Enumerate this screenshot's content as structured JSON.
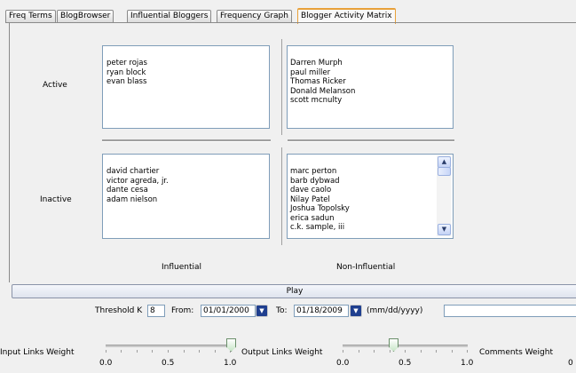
{
  "tabs": [
    {
      "label": "Freq Terms"
    },
    {
      "label": "BlogBrowser"
    },
    {
      "label": "Influential Bloggers"
    },
    {
      "label": "Frequency Graph"
    },
    {
      "label": "Blogger Activity Matrix",
      "active": true
    }
  ],
  "matrix": {
    "rows": [
      "Active",
      "Inactive"
    ],
    "columns": [
      "Influential",
      "Non-Influential"
    ],
    "active_influential": [
      "peter rojas",
      "ryan block",
      "evan blass"
    ],
    "active_noninfluential": [
      "Darren Murph",
      "paul miller",
      "Thomas Ricker",
      "Donald Melanson",
      "scott mcnulty"
    ],
    "inactive_influential": [
      "david chartier",
      "victor agreda, jr.",
      "dante cesa",
      "adam nielson"
    ],
    "inactive_noninfluential": [
      "marc perton",
      "barb dybwad",
      "dave caolo",
      "Nilay Patel",
      "Joshua Topolsky",
      "erica sadun",
      "c.k. sample, iii"
    ]
  },
  "play_label": "Play",
  "controls": {
    "threshold_label": "Threshold K",
    "threshold_value": "8",
    "from_label": "From:",
    "from_value": "01/01/2000",
    "to_label": "To:",
    "to_value": "01/18/2009",
    "date_format_hint": "(mm/dd/yyyy)",
    "search_value": ""
  },
  "sliders": {
    "input_links": {
      "label": "Input Links Weight",
      "value": 1.0,
      "ticks": [
        "0.0",
        "0.5",
        "1.0"
      ]
    },
    "output_links": {
      "label": "Output Links Weight",
      "value": 0.4,
      "ticks": [
        "0.0",
        "0.5",
        "1.0"
      ]
    },
    "comments": {
      "label": "Comments Weight",
      "ticks": [
        "0"
      ]
    }
  },
  "icons": {
    "calendar": "calendar-dropdown-icon",
    "scroll_up": "scroll-up-icon",
    "scroll_down": "scroll-down-icon"
  }
}
